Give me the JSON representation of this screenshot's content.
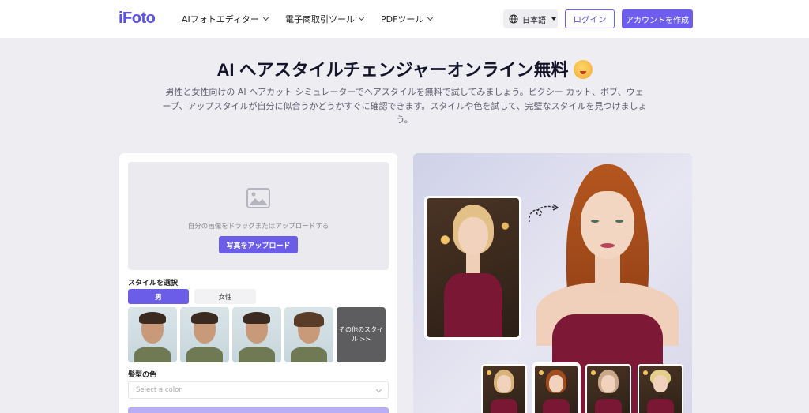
{
  "header": {
    "logo": "iFoto",
    "nav": [
      {
        "label": "AIフォトエディター"
      },
      {
        "label": "電子商取引ツール"
      },
      {
        "label": "PDFツール"
      }
    ],
    "language": "日本語",
    "login": "ログイン",
    "signup": "アカウントを作成"
  },
  "hero": {
    "title": "AI ヘアスタイルチェンジャーオンライン無料",
    "subtitle": "男性と女性向けの AI ヘアカット シミュレーターでヘアスタイルを無料で試してみましょう。ピクシー カット、ボブ、ウェーブ、アップスタイルが自分に似合うかどうかすぐに確認できます。スタイルや色を試して、完璧なスタイルを見つけましょう。"
  },
  "uploader": {
    "hint": "自分の画像をドラッグまたはアップロードする",
    "button": "写真をアップロード"
  },
  "style_section": {
    "label": "スタイルを選択",
    "gender_tabs": [
      {
        "label": "男",
        "selected": true
      },
      {
        "label": "女性",
        "selected": false
      }
    ],
    "more": "その他のスタイル >>"
  },
  "color_section": {
    "label": "髪型の色",
    "placeholder": "Select a color"
  },
  "colors": {
    "accent": "#6b5de8",
    "logo": "#5a52e6"
  }
}
